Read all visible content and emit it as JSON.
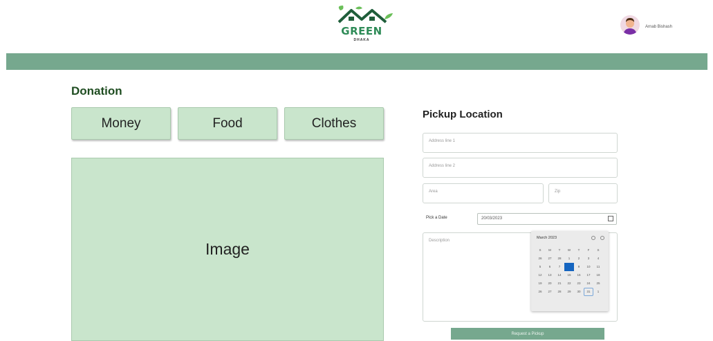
{
  "header": {
    "logo_text": "GREEN",
    "logo_sub": "DHAKA",
    "user_name": "Arnab Bishash"
  },
  "donation": {
    "title": "Donation",
    "types": [
      "Money",
      "Food",
      "Clothes"
    ],
    "image_placeholder": "Image"
  },
  "pickup": {
    "title": "Pickup Location",
    "address1_placeholder": "Address line 1",
    "address2_placeholder": "Address line 2",
    "area_placeholder": "Area",
    "zip_placeholder": "Zip",
    "date_label": "Pick a Date",
    "date_value": "20/03/2023",
    "description_placeholder": "Description",
    "submit_label": "Request a Pickup"
  },
  "calendar": {
    "month_label": "March 2023",
    "weekdays": [
      "S",
      "M",
      "T",
      "W",
      "T",
      "F",
      "S"
    ],
    "days": [
      "26",
      "27",
      "28",
      "1",
      "2",
      "3",
      "4",
      "5",
      "6",
      "7",
      "8",
      "9",
      "10",
      "11",
      "12",
      "13",
      "14",
      "15",
      "16",
      "17",
      "18",
      "19",
      "20",
      "21",
      "22",
      "23",
      "24",
      "25",
      "26",
      "27",
      "28",
      "29",
      "30",
      "31",
      "1"
    ],
    "selected_day": "8",
    "highlighted_day": "31"
  },
  "colors": {
    "header_bar": "#76a88e",
    "card_fill": "#c9e5cc",
    "title_green": "#1f4d21",
    "selected_date": "#1565c0"
  }
}
